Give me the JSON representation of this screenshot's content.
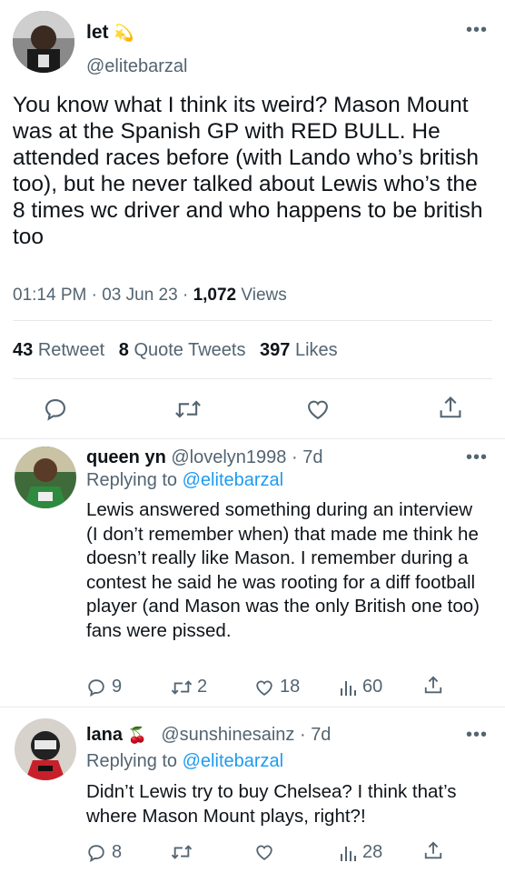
{
  "main_tweet": {
    "display_name": "let",
    "emoji": "💫",
    "handle": "@elitebarzal",
    "text": "You know what I think its weird? Mason Mount was at the Spanish GP with RED BULL. He attended races before (with Lando who’s british too), but he never talked about Lewis who’s the 8 times wc driver and who happens to be british too",
    "time": "01:14 PM",
    "date": "03 Jun 23",
    "views_count": "1,072",
    "views_label": "Views",
    "retweets_count": "43",
    "retweets_label": "Retweet",
    "quotes_count": "8",
    "quotes_label": "Quote Tweets",
    "likes_count": "397",
    "likes_label": "Likes"
  },
  "replies": [
    {
      "display_name": "queen yn",
      "handle": "@lovelyn1998",
      "age": "7d",
      "replying_prefix": "Replying to",
      "replying_to": "@elitebarzal",
      "text": "Lewis answered something during an interview (I don’t remember when) that made me think he doesn’t really like Mason. I remember during a contest he said he was rooting for a diff football player (and Mason was the only British one too) fans were pissed.",
      "replies": "9",
      "retweets": "2",
      "likes": "18",
      "views": "60"
    },
    {
      "display_name": "lana",
      "emoji": "🍒",
      "handle": "@sunshinesainz",
      "age": "7d",
      "replying_prefix": "Replying to",
      "replying_to": "@elitebarzal",
      "text": "Didn’t Lewis try to buy Chelsea? I think that’s where Mason Mount plays, right?!",
      "replies": "8",
      "retweets": "",
      "likes": "",
      "views": "28"
    }
  ],
  "icons": {
    "reply": "speech-bubble-icon",
    "retweet": "retweet-icon",
    "like": "heart-icon",
    "share": "share-icon",
    "views": "bar-chart-icon",
    "more": "more-dots-icon"
  },
  "colors": {
    "link": "#1d9bf0",
    "muted": "#536471",
    "divider": "#e6e9ec"
  }
}
